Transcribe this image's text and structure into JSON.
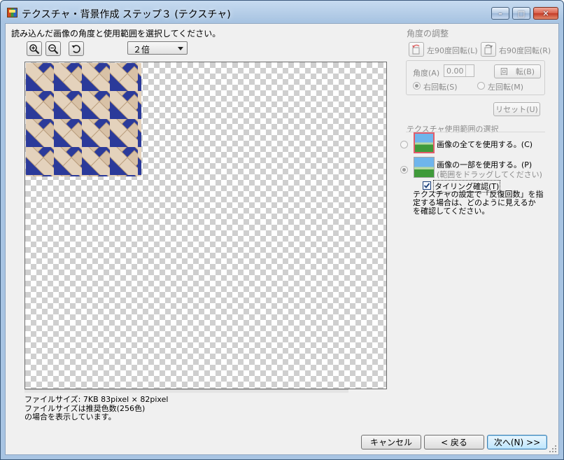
{
  "window": {
    "title": "テクスチャ・背景作成 ステップ３ (テクスチャ)",
    "min_label": "–",
    "max_label": "□",
    "close_label": "✕"
  },
  "instruction": "読み込んだ画像の角度と使用範囲を選択してください。",
  "toolbar": {
    "zoom_in_icon": "zoom-in-icon",
    "zoom_out_icon": "zoom-out-icon",
    "undo_icon": "undo-icon",
    "zoom_value": "２倍"
  },
  "file_info": {
    "size_line": "ファイルサイズ: 7KB 83pixel × 82pixel",
    "note_line1": "ファイルサイズは推奨色数(256色)",
    "note_line2": "の場合を表示しています。"
  },
  "angle_panel": {
    "heading": "角度の調整",
    "rotate_left": "左90度回転(L)",
    "rotate_right": "右90度回転(R)",
    "angle_label": "角度(A)",
    "angle_value": "0.00",
    "rotate_button": "回　転(B)",
    "clockwise": "右回転(S)",
    "counterclockwise": "左回転(M)",
    "reset": "リセット(U)"
  },
  "range_panel": {
    "heading": "テクスチャ使用範囲の選択",
    "use_all": "画像の全てを使用する。(C)",
    "use_part": "画像の一部を使用する。(P)",
    "use_part_hint": "(範囲をドラッグしてください)",
    "tiling_check": "タイリング確認(T)",
    "tiling_checked": true,
    "description": [
      "テクスチャの設定で「反復回数」を指",
      "定する場合は、どのように見えるか",
      "を確認してください。"
    ]
  },
  "footer": {
    "cancel": "キャンセル",
    "back": "< 戻る",
    "next": "次へ(N) >>"
  },
  "colors": {
    "accent": "#3c7fb1",
    "weave_blue": "#2b3a9a",
    "weave_wood": "#d8c1a6",
    "disabled_text": "#8c8c8c"
  }
}
